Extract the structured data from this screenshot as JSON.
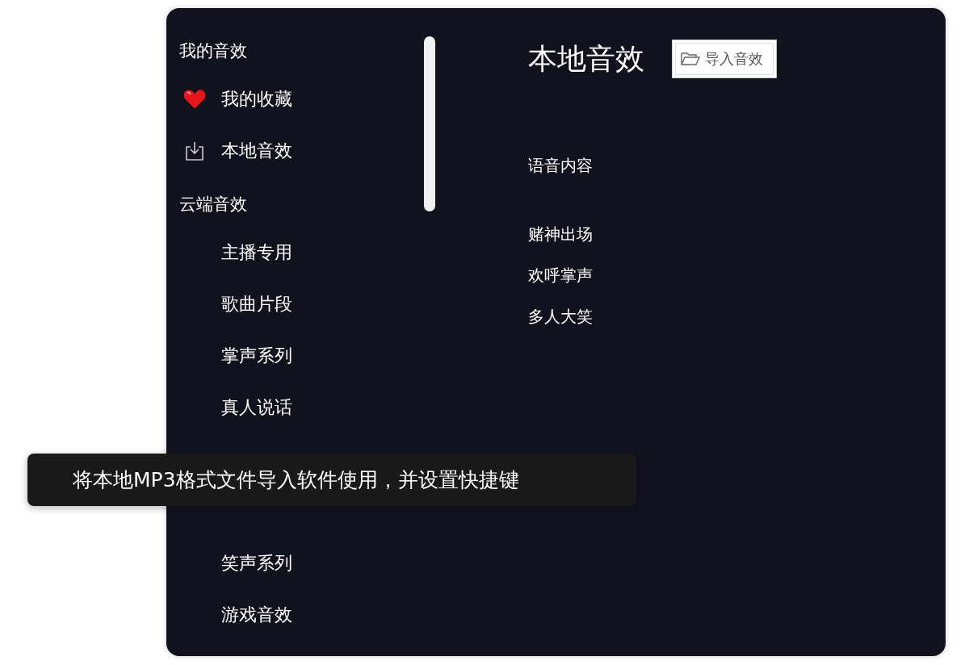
{
  "sidebar": {
    "groups": [
      {
        "title": "我的音效",
        "items": [
          {
            "label": "我的收藏",
            "kind": "favorite"
          },
          {
            "label": "本地音效",
            "kind": "local"
          }
        ]
      },
      {
        "title": "云端音效",
        "items": [
          {
            "label": "主播专用",
            "kind": "plain"
          },
          {
            "label": "歌曲片段",
            "kind": "plain"
          },
          {
            "label": "掌声系列",
            "kind": "plain"
          },
          {
            "label": "真人说话",
            "kind": "plain"
          },
          {
            "kind": "tooltip-slot"
          },
          {
            "label": "笑声系列",
            "kind": "plain"
          },
          {
            "label": "游戏音效",
            "kind": "plain"
          }
        ]
      }
    ]
  },
  "main": {
    "title": "本地音效",
    "import_button": "导入音效",
    "column_header": "语音内容",
    "sounds": [
      "赌神出场",
      "欢呼掌声",
      "多人大笑"
    ]
  },
  "tooltip": "将本地MP3格式文件导入软件使用，并设置快捷键"
}
